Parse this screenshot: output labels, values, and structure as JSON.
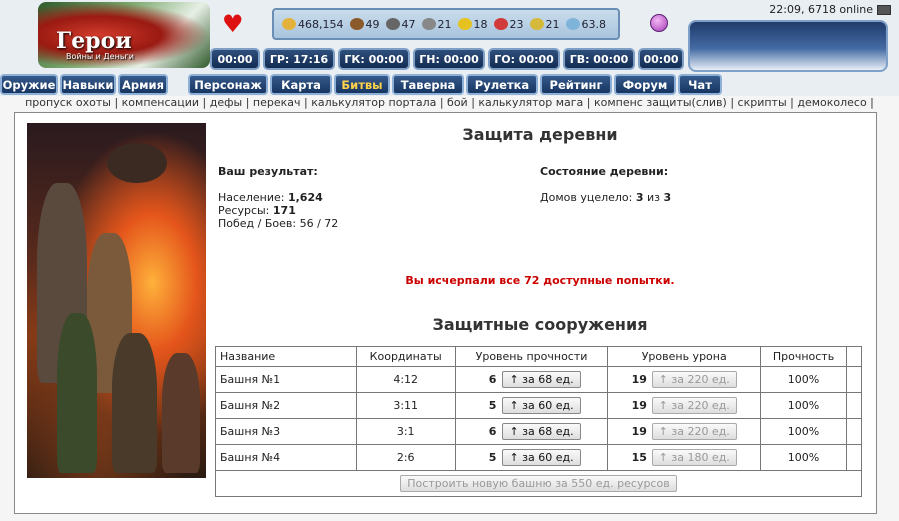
{
  "header": {
    "logo_title": "Герои",
    "logo_subtitle": "Войны и Деньги",
    "time_online": "22:09, 6718 online",
    "resources": [
      {
        "icon": "gold-icon",
        "value": "468,154",
        "color": "#e3b23c"
      },
      {
        "icon": "wood-icon",
        "value": "49",
        "color": "#8a5a2b"
      },
      {
        "icon": "ore-icon",
        "value": "47",
        "color": "#666666"
      },
      {
        "icon": "mercury-icon",
        "value": "21",
        "color": "#888888"
      },
      {
        "icon": "sulfur-icon",
        "value": "18",
        "color": "#e5c21f"
      },
      {
        "icon": "crystal-icon",
        "value": "23",
        "color": "#d23b3b"
      },
      {
        "icon": "gems-icon",
        "value": "21",
        "color": "#d4b93a"
      },
      {
        "icon": "diamond-icon",
        "value": "63.8",
        "color": "#7fb3d9"
      }
    ],
    "timers": [
      "00:00",
      "ГР: 17:16",
      "ГК: 00:00",
      "ГН: 00:00",
      "ГО: 00:00",
      "ГВ: 00:00",
      "00:00"
    ],
    "nav": [
      "Оружие",
      "Навыки",
      "Армия",
      "Персонаж",
      "Карта",
      "Битвы",
      "Таверна",
      "Рулетка",
      "Рейтинг",
      "Форум",
      "Чат"
    ],
    "links": "пропуск охоты | компенсации | дефы | перекач | калькулятор портала | бой | калькулятор мага | компенс защиты(слив) | скрипты | демоколесо |"
  },
  "main": {
    "title": "Защита деревни",
    "result_head": "Ваш результат:",
    "population_label": "Население:",
    "population_value": "1,624",
    "resources_label": "Ресурсы:",
    "resources_value": "171",
    "wins_label": "Побед / Боев:",
    "wins_value": "56 / 72",
    "village_head": "Состояние деревни:",
    "houses_label": "Домов уцелело:",
    "houses_value": "3",
    "houses_of": "из",
    "houses_total": "3",
    "warning": "Вы исчерпали все 72 доступные попытки.",
    "defense_title": "Защитные сооружения"
  },
  "table": {
    "headers": [
      "Название",
      "Координаты",
      "Уровень прочности",
      "Уровень урона",
      "Прочность"
    ],
    "rows": [
      {
        "name": "Башня №1",
        "coords": "4:12",
        "dur": "6",
        "dur_btn": "↑ за 68 ед.",
        "dmg": "19",
        "dmg_btn": "↑ за 220 ед.",
        "str": "100%"
      },
      {
        "name": "Башня №2",
        "coords": "3:11",
        "dur": "5",
        "dur_btn": "↑ за 60 ед.",
        "dmg": "19",
        "dmg_btn": "↑ за 220 ед.",
        "str": "100%"
      },
      {
        "name": "Башня №3",
        "coords": "3:1",
        "dur": "6",
        "dur_btn": "↑ за 68 ед.",
        "dmg": "19",
        "dmg_btn": "↑ за 220 ед.",
        "str": "100%"
      },
      {
        "name": "Башня №4",
        "coords": "2:6",
        "dur": "5",
        "dur_btn": "↑ за 60 ед.",
        "dmg": "15",
        "dmg_btn": "↑ за 180 ед.",
        "str": "100%"
      }
    ],
    "build_button": "Построить новую башню за 550 ед. ресурсов"
  }
}
